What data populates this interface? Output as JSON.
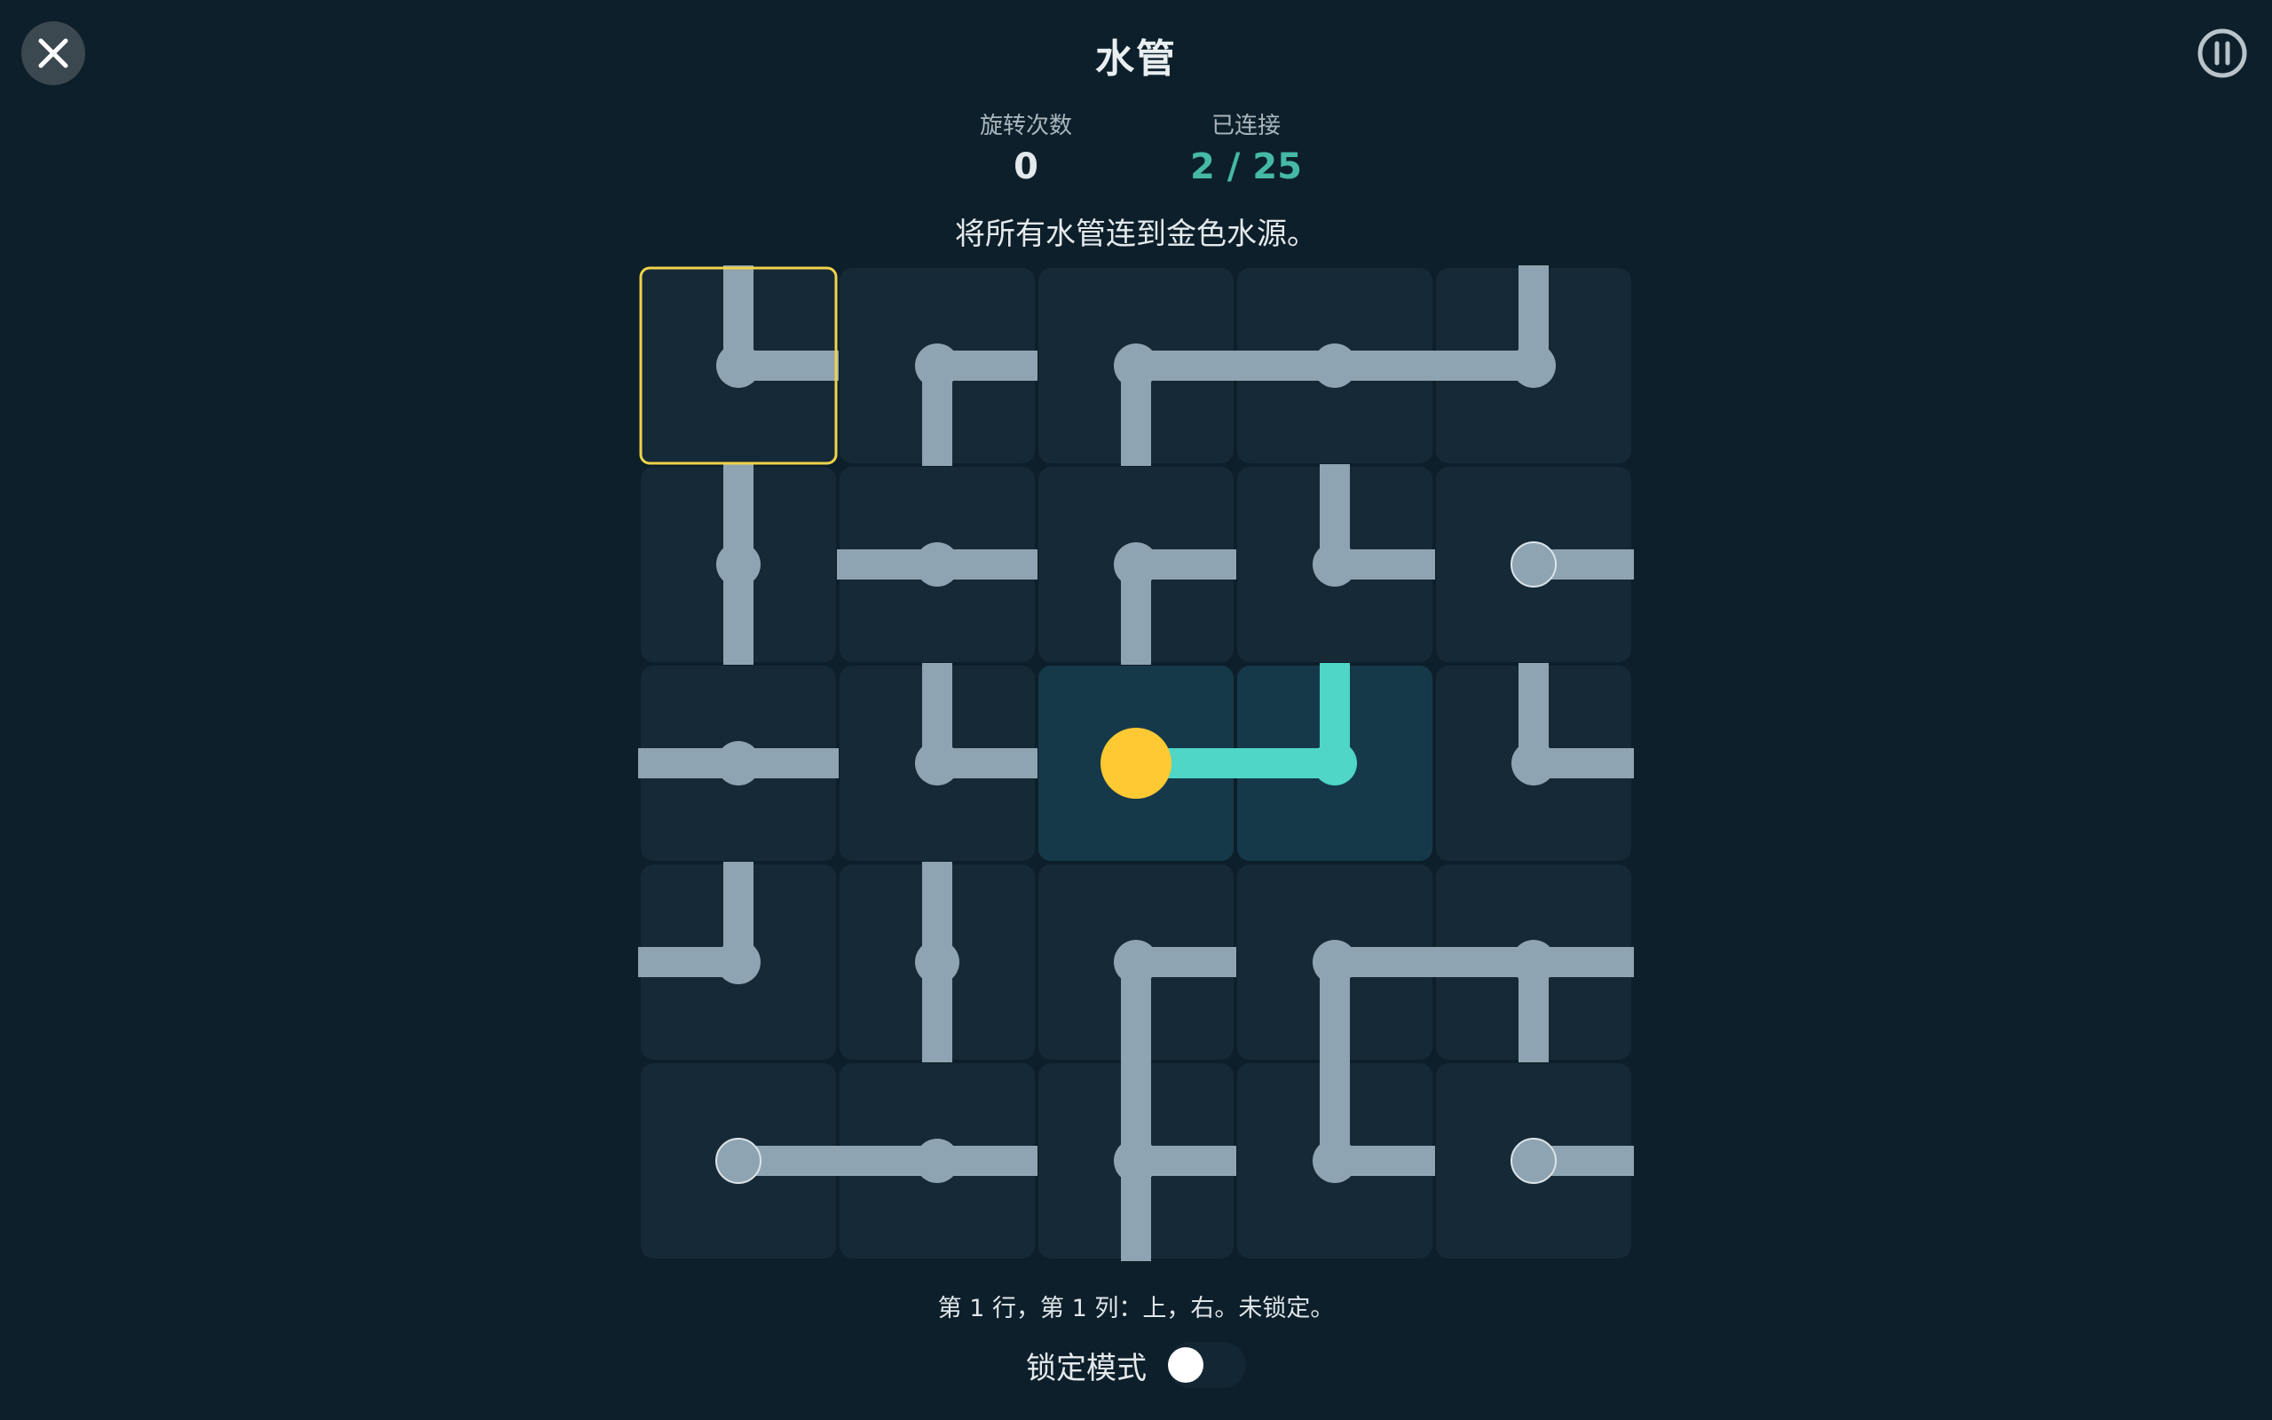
{
  "header": {
    "title": "水管",
    "close_icon": "close-icon",
    "pause_icon": "pause-icon"
  },
  "stats": {
    "rotations_label": "旋转次数",
    "rotations_value": "0",
    "connected_label": "已连接",
    "connected_value": "2 / 25"
  },
  "instruction": "将所有水管连到金色水源。",
  "status": "第 1 行，第 1 列：上，右。未锁定。",
  "lock_mode": {
    "label": "锁定模式",
    "enabled": false
  },
  "colors": {
    "background": "#0d1f2a",
    "tile": "#152a36",
    "tile_connected": "#16394a",
    "pipe": "#8fa4b2",
    "pipe_connected": "#4fd6c6",
    "source": "#ffc933",
    "selection": "#f0d24a"
  },
  "grid": {
    "rows": 5,
    "cols": 5,
    "selected": [
      0,
      0
    ],
    "source": [
      2,
      2
    ],
    "tiles": [
      [
        {
          "conn": [
            "N",
            "E"
          ],
          "connected": false,
          "end": false
        },
        {
          "conn": [
            "E",
            "S"
          ],
          "connected": false,
          "end": false
        },
        {
          "conn": [
            "E",
            "S"
          ],
          "connected": false,
          "end": false
        },
        {
          "conn": [
            "W",
            "E"
          ],
          "connected": false,
          "end": false
        },
        {
          "conn": [
            "N",
            "W"
          ],
          "connected": false,
          "end": false
        }
      ],
      [
        {
          "conn": [
            "N",
            "S"
          ],
          "connected": false,
          "end": false
        },
        {
          "conn": [
            "W",
            "E"
          ],
          "connected": false,
          "end": false
        },
        {
          "conn": [
            "E",
            "S"
          ],
          "connected": false,
          "end": false
        },
        {
          "conn": [
            "N",
            "E"
          ],
          "connected": false,
          "end": false
        },
        {
          "conn": [
            "E"
          ],
          "connected": false,
          "end": true
        }
      ],
      [
        {
          "conn": [
            "W",
            "E"
          ],
          "connected": false,
          "end": false
        },
        {
          "conn": [
            "N",
            "E"
          ],
          "connected": false,
          "end": false
        },
        {
          "conn": [
            "E"
          ],
          "connected": true,
          "end": false
        },
        {
          "conn": [
            "N",
            "W"
          ],
          "connected": true,
          "end": false
        },
        {
          "conn": [
            "N",
            "E"
          ],
          "connected": false,
          "end": false
        }
      ],
      [
        {
          "conn": [
            "N",
            "W"
          ],
          "connected": false,
          "end": false
        },
        {
          "conn": [
            "N",
            "S"
          ],
          "connected": false,
          "end": false
        },
        {
          "conn": [
            "E",
            "S"
          ],
          "connected": false,
          "end": false
        },
        {
          "conn": [
            "E",
            "S"
          ],
          "connected": false,
          "end": false
        },
        {
          "conn": [
            "W",
            "E",
            "S"
          ],
          "connected": false,
          "end": false
        }
      ],
      [
        {
          "conn": [
            "E"
          ],
          "connected": false,
          "end": true
        },
        {
          "conn": [
            "W",
            "E"
          ],
          "connected": false,
          "end": false
        },
        {
          "conn": [
            "N",
            "E",
            "S"
          ],
          "connected": false,
          "end": false
        },
        {
          "conn": [
            "N",
            "E"
          ],
          "connected": false,
          "end": false
        },
        {
          "conn": [
            "E"
          ],
          "connected": false,
          "end": true
        }
      ]
    ]
  }
}
